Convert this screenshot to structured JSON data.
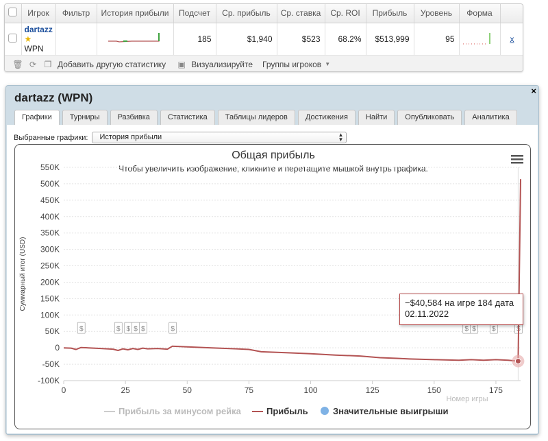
{
  "table": {
    "headers": [
      "Игрок",
      "Фильтр",
      "История прибыли",
      "Подсчет",
      "Ср. прибыль",
      "Ср. ставка",
      "Ср. ROI",
      "Прибыль",
      "Уровень",
      "Форма"
    ],
    "row": {
      "player": "dartazz",
      "room": "WPN",
      "count": "185",
      "avg_profit": "$1,940",
      "avg_stake": "$523",
      "avg_roi": "68.2%",
      "profit": "$513,999",
      "level": "95",
      "remove": "x"
    },
    "icons": {
      "trash": "trash-icon",
      "refresh": "refresh-icon",
      "add": "add-icon",
      "image": "image-icon"
    }
  },
  "toolbar": {
    "add_stat": "Добавить другую статистику",
    "visualize": "Визуализируйте",
    "groups": "Группы игроков"
  },
  "window": {
    "title": "dartazz (WPN)",
    "close": "×",
    "tabs": [
      "Графики",
      "Турниры",
      "Разбивка",
      "Статистика",
      "Таблицы лидеров",
      "Достижения",
      "Найти",
      "Опубликовать",
      "Аналитика"
    ],
    "active_tab": 0,
    "select_label": "Выбранные графики:",
    "select_value": "История прибыли"
  },
  "chart_data": {
    "type": "line",
    "title": "Общая прибыль",
    "subtitle": "Чтобы увеличить изображение, кликните и перетащите мышкой внутрь графика.",
    "ylabel": "Суммарный итог (USD)",
    "xlabel": "Номер игры",
    "ylim": [
      -100000,
      550000
    ],
    "xlim": [
      0,
      185
    ],
    "y_ticks": [
      "550K",
      "500K",
      "450K",
      "400K",
      "350K",
      "300K",
      "250K",
      "200K",
      "150K",
      "100K",
      "50K",
      "0",
      "-50K",
      "-100K"
    ],
    "x_ticks": [
      "0",
      "25",
      "50",
      "75",
      "100",
      "125",
      "150",
      "175"
    ],
    "grid": true,
    "series": [
      {
        "name": "Прибыль",
        "color": "#b35353",
        "points": [
          [
            0,
            0
          ],
          [
            3,
            -1000
          ],
          [
            5,
            -5000
          ],
          [
            7,
            1000
          ],
          [
            10,
            0
          ],
          [
            15,
            -2000
          ],
          [
            20,
            -4000
          ],
          [
            22,
            -8000
          ],
          [
            24,
            -3000
          ],
          [
            26,
            -6000
          ],
          [
            28,
            -2000
          ],
          [
            30,
            -5000
          ],
          [
            32,
            -1000
          ],
          [
            34,
            -3000
          ],
          [
            38,
            -2000
          ],
          [
            42,
            -4000
          ],
          [
            44,
            5000
          ],
          [
            50,
            3000
          ],
          [
            60,
            0
          ],
          [
            70,
            -3000
          ],
          [
            75,
            -5000
          ],
          [
            80,
            -12000
          ],
          [
            90,
            -15000
          ],
          [
            100,
            -18000
          ],
          [
            110,
            -22000
          ],
          [
            120,
            -25000
          ],
          [
            128,
            -30000
          ],
          [
            135,
            -32000
          ],
          [
            140,
            -34000
          ],
          [
            150,
            -36000
          ],
          [
            160,
            -38000
          ],
          [
            165,
            -36000
          ],
          [
            170,
            -38000
          ],
          [
            175,
            -36000
          ],
          [
            180,
            -38000
          ],
          [
            184,
            -40584
          ],
          [
            185,
            513999
          ]
        ]
      }
    ],
    "legend": [
      {
        "name": "Прибыль за минусом рейка",
        "color": "#cccccc"
      },
      {
        "name": "Прибыль",
        "color": "#b35353"
      },
      {
        "name": "Значительные выигрыши",
        "color": "#7fb2e5"
      }
    ],
    "legend_placement": "bottom",
    "big_win_markers": [
      [
        7,
        0
      ],
      [
        22,
        0
      ],
      [
        26,
        0
      ],
      [
        29,
        0
      ],
      [
        32,
        0
      ],
      [
        44,
        0
      ],
      [
        163,
        0
      ],
      [
        166,
        0
      ],
      [
        174,
        0
      ],
      [
        184,
        0
      ]
    ],
    "tooltip": {
      "line1": "−$40,584 на игре 184 дата",
      "line2": "02.11.2022"
    }
  }
}
